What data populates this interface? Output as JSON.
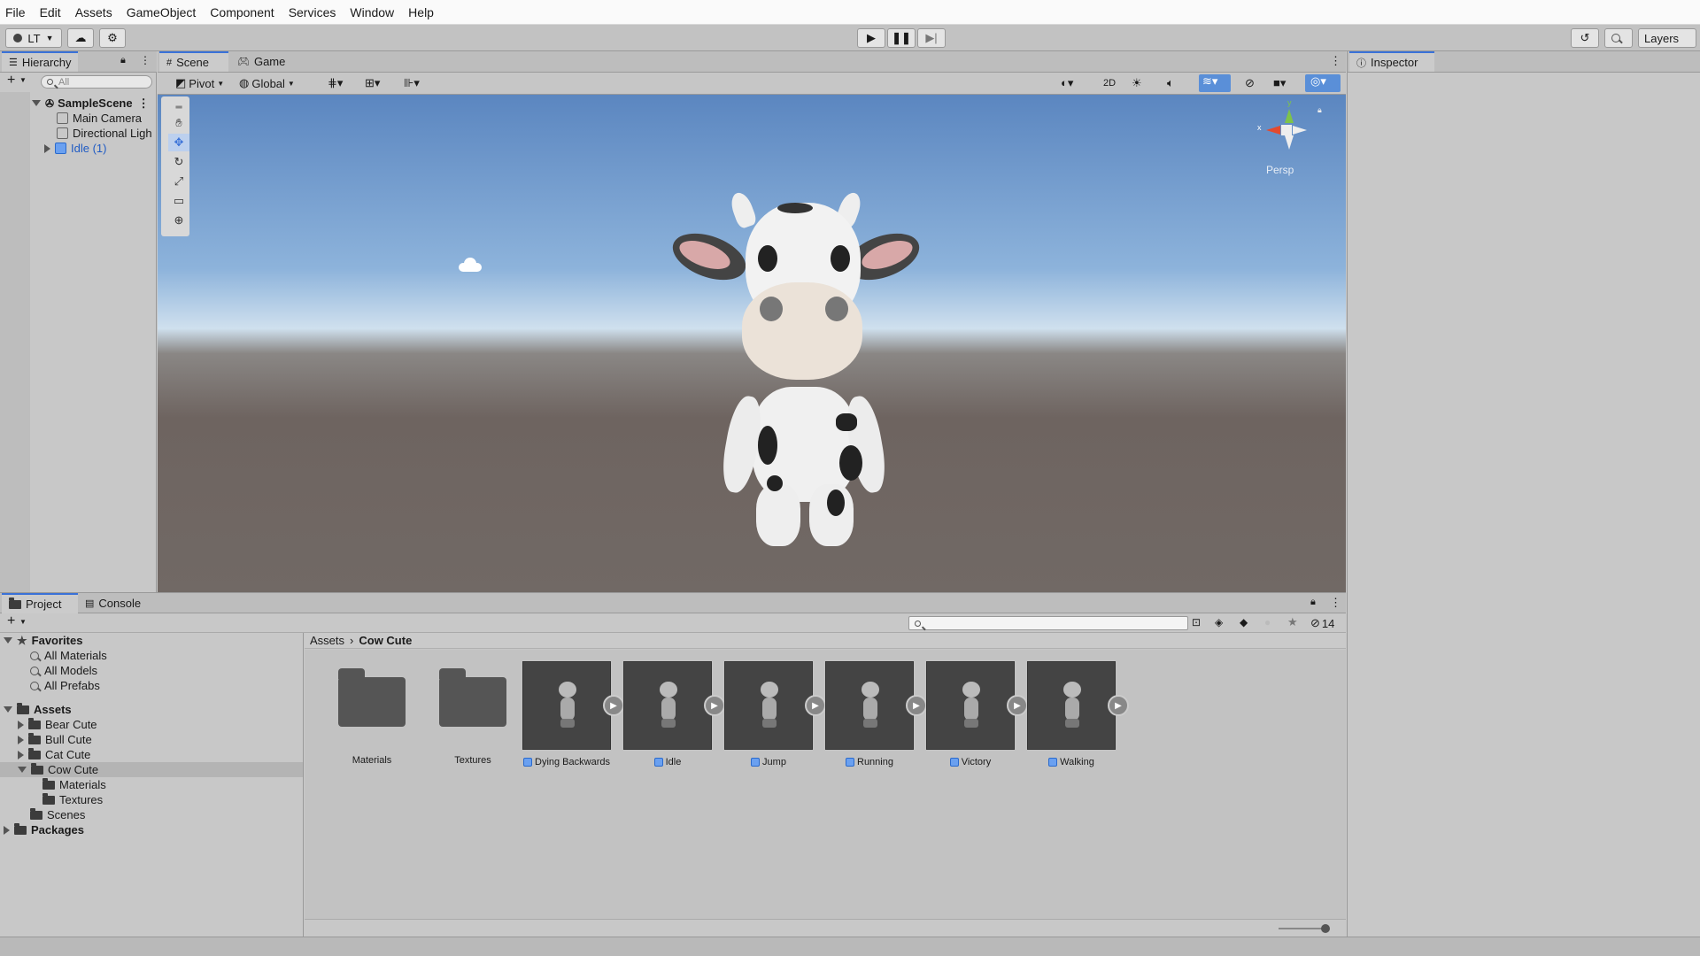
{
  "menu": [
    "File",
    "Edit",
    "Assets",
    "GameObject",
    "Component",
    "Services",
    "Window",
    "Help"
  ],
  "toolbar": {
    "account": "LT",
    "layers": "Layers"
  },
  "hierarchy": {
    "tab": "Hierarchy",
    "search_placeholder": "All",
    "scene": "SampleScene",
    "items": [
      "Main Camera",
      "Directional Ligh",
      "Idle (1)"
    ]
  },
  "scene": {
    "tabs": [
      "Scene",
      "Game"
    ],
    "pivot": "Pivot",
    "global": "Global",
    "mode_2d": "2D",
    "persp": "Persp",
    "gizmo_y": "y",
    "gizmo_x": "x"
  },
  "inspector": {
    "tab": "Inspector"
  },
  "project": {
    "tabs": [
      "Project",
      "Console"
    ],
    "hidden_count": "14",
    "favorites_label": "Favorites",
    "favorites": [
      "All Materials",
      "All Models",
      "All Prefabs"
    ],
    "assets_label": "Assets",
    "asset_folders": [
      "Bear Cute",
      "Bull Cute",
      "Cat Cute",
      "Cow Cute"
    ],
    "cow_children": [
      "Materials",
      "Textures"
    ],
    "scenes": "Scenes",
    "packages": "Packages",
    "breadcrumb": [
      "Assets",
      "Cow Cute"
    ],
    "grid_items": [
      {
        "label": "Materials",
        "kind": "folder"
      },
      {
        "label": "Textures",
        "kind": "folder"
      },
      {
        "label": "Dying Backwards",
        "kind": "anim"
      },
      {
        "label": "Idle",
        "kind": "anim"
      },
      {
        "label": "Jump",
        "kind": "anim"
      },
      {
        "label": "Running",
        "kind": "anim"
      },
      {
        "label": "Victory",
        "kind": "anim"
      },
      {
        "label": "Walking",
        "kind": "anim"
      }
    ]
  }
}
